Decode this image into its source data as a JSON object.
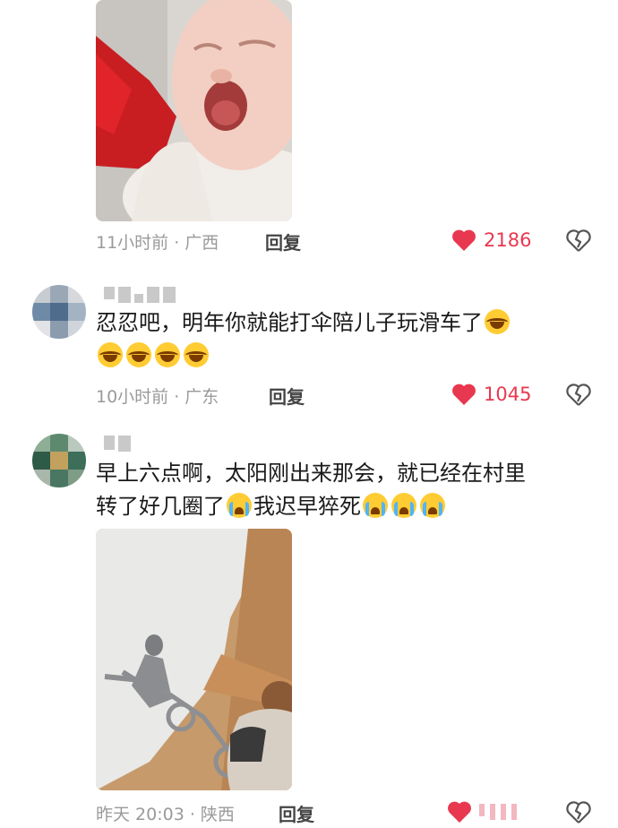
{
  "comments": [
    {
      "time": "11小时前 · 广西",
      "reply_label": "回复",
      "likes": "2186"
    },
    {
      "text_line1": "忍忍吧，明年你就能打伞陪儿子玩滑车了",
      "time": "10小时前 · 广东",
      "reply_label": "回复",
      "likes": "1045",
      "emojis": [
        "laugh-emoji",
        "laugh-emoji",
        "laugh-emoji",
        "laugh-emoji",
        "laugh-emoji"
      ]
    },
    {
      "text_line1": "早上六点啊，太阳刚出来那会，就已经在村里",
      "text_line2": "转了好几圈了",
      "text_line2b": "我迟早猝死",
      "time": "昨天 20:03 · 陕西",
      "reply_label": "回复",
      "emojis": [
        "cry-emoji",
        "cry-emoji",
        "cry-emoji",
        "cry-emoji"
      ]
    }
  ],
  "colors": {
    "like": "#e8384f",
    "meta": "#9a9a9a",
    "text": "#1a1a1a"
  },
  "icons": {
    "like": "heart-icon",
    "dislike": "broken-heart-icon"
  }
}
